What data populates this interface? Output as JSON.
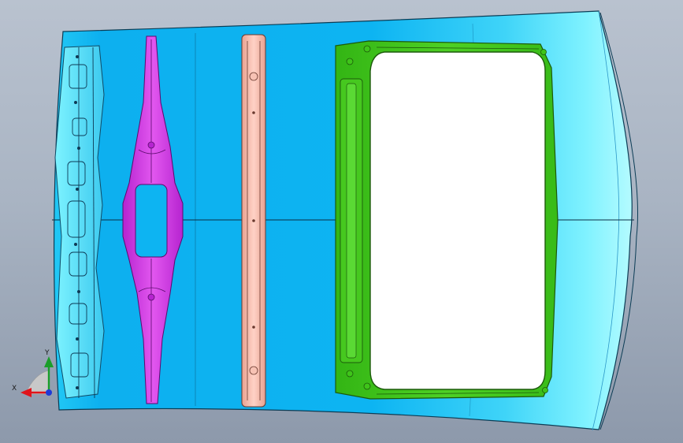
{
  "viewport": {
    "background_top": "#b9c2cf",
    "background_bottom": "#8d99ab"
  },
  "model": {
    "roof_panel_color": "#0eb3f0",
    "roof_panel_edge_color": "#7ff0ff",
    "front_header_color": "#37d3f0",
    "front_bow_color": "#cc33e0",
    "mid_bow_color": "#f3b6a6",
    "sunroof_frame_color": "#3fc41a",
    "sunroof_opening_color": "#ffffff"
  },
  "triad": {
    "x_label": "X",
    "y_label": "Y",
    "x_color": "#e0141b",
    "y_color": "#1a9e2a",
    "z_color": "#1f3ad6"
  }
}
